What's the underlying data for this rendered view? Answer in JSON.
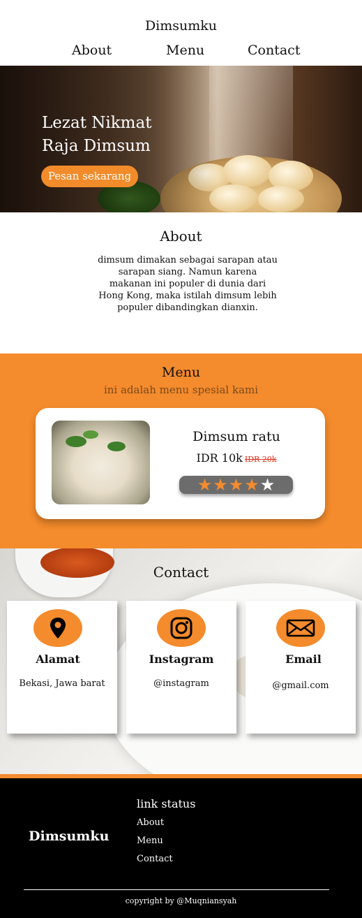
{
  "header": {
    "brand": "Dimsumku",
    "nav": [
      "About",
      "Menu",
      "Contact"
    ]
  },
  "hero": {
    "title_line1": "Lezat Nikmat",
    "title_line2": "Raja Dimsum",
    "cta": "Pesan sekarang"
  },
  "about": {
    "title": "About",
    "text": "dimsum dimakan sebagai sarapan atau sarapan siang. Namun karena makanan ini populer di dunia dari Hong Kong, maka istilah dimsum lebih populer dibandingkan dianxin."
  },
  "menu": {
    "title": "Menu",
    "subtitle": "ini adalah menu spesial kami",
    "item": {
      "name": "Dimsum ratu",
      "price": "IDR 10k",
      "old_price": "IDR 20k",
      "rating": 4,
      "rating_max": 5
    }
  },
  "contact": {
    "title": "Contact",
    "cards": [
      {
        "icon": "location-pin-icon",
        "title": "Alamat",
        "value": "Bekasi, Jawa barat"
      },
      {
        "icon": "instagram-icon",
        "title": "Instagram",
        "value": "@instagram"
      },
      {
        "icon": "envelope-icon",
        "title": "Email",
        "value": "@gmail.com"
      }
    ]
  },
  "footer": {
    "brand": "Dimsumku",
    "links_title": "link status",
    "links": [
      "About",
      "Menu",
      "Contact"
    ],
    "copyright": "copyright by @Muqniansyah"
  },
  "colors": {
    "accent": "#f48b2c",
    "footer_bg": "#000000"
  }
}
